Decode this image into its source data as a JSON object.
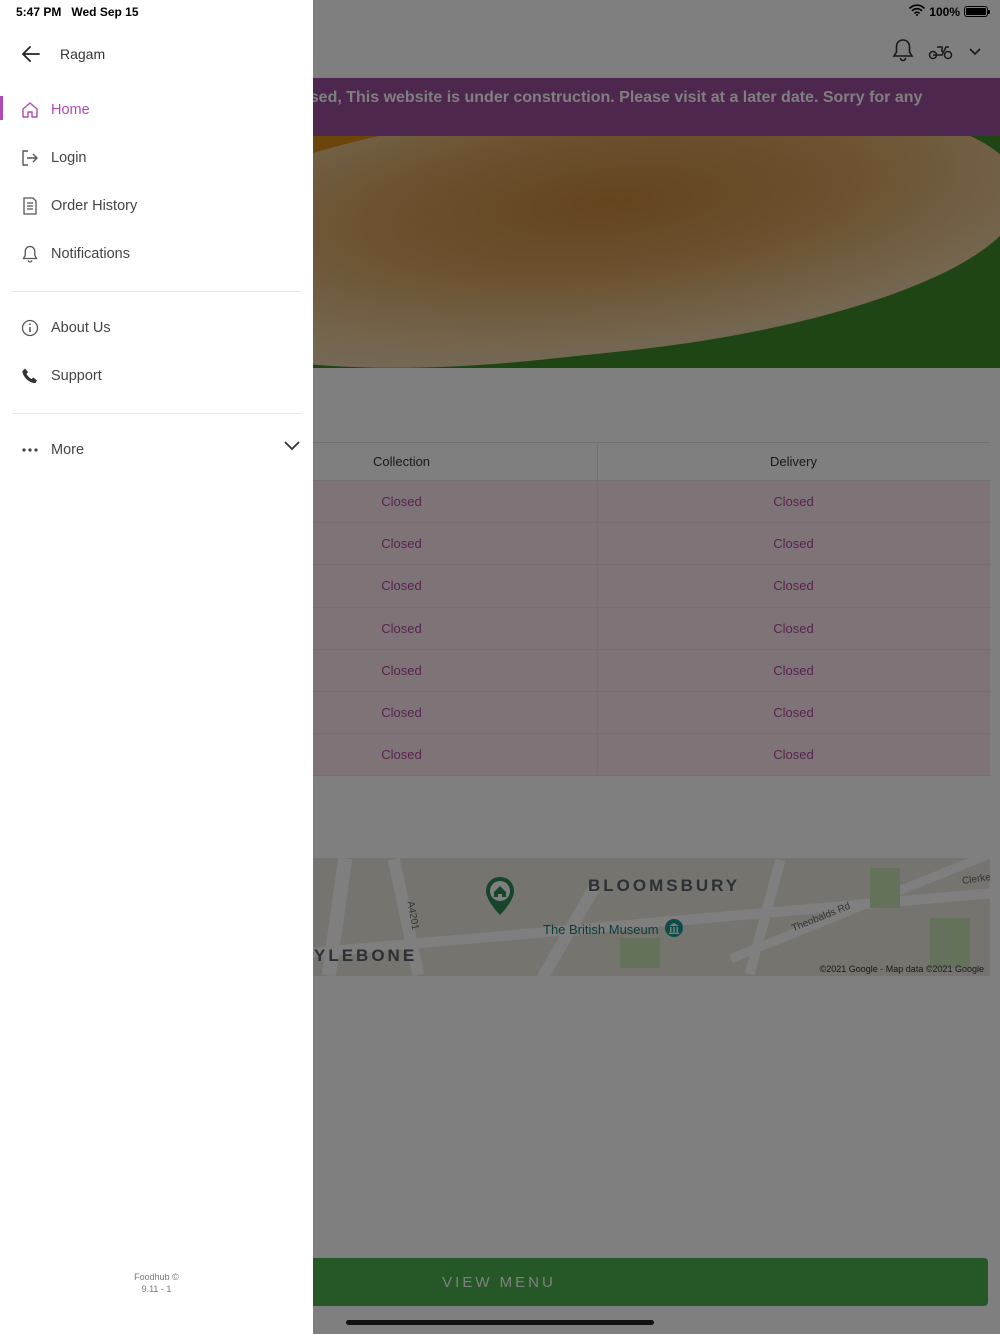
{
  "status_bar": {
    "time": "5:47 PM",
    "date": "Wed Sep 15",
    "battery": "100%"
  },
  "drawer": {
    "title": "Ragam",
    "items": [
      {
        "label": "Home",
        "icon": "home-icon",
        "active": true
      },
      {
        "label": "Login",
        "icon": "login-icon"
      },
      {
        "label": "Order History",
        "icon": "receipt-icon"
      },
      {
        "label": "Notifications",
        "icon": "bell-icon"
      },
      {
        "label": "About Us",
        "icon": "info-icon"
      },
      {
        "label": "Support",
        "icon": "phone-icon"
      },
      {
        "label": "More",
        "icon": "more-dots-icon"
      }
    ],
    "footer_line1": "Foodhub ©",
    "footer_line2": "9.11 - 1"
  },
  "main": {
    "banner": "osed, This website is under construction. Please visit at a later date. Sorry for any",
    "hours": {
      "col_collection": "Collection",
      "col_delivery": "Delivery",
      "rows": [
        {
          "collection": "Closed",
          "delivery": "Closed"
        },
        {
          "collection": "Closed",
          "delivery": "Closed"
        },
        {
          "collection": "Closed",
          "delivery": "Closed"
        },
        {
          "collection": "Closed",
          "delivery": "Closed"
        },
        {
          "collection": "Closed",
          "delivery": "Closed"
        },
        {
          "collection": "Closed",
          "delivery": "Closed"
        },
        {
          "collection": "Closed",
          "delivery": "Closed"
        }
      ]
    },
    "map": {
      "area_label": "BLOOMSBURY",
      "area_label2": "YLEBONE",
      "poi": "The British Museum",
      "road1": "A4201",
      "road2": "Theobalds Rd",
      "road3": "Clerke",
      "copyright": "©2021 Google - Map data ©2021 Google"
    },
    "view_menu": "VIEW MENU"
  },
  "colors": {
    "accent": "#b04ab5",
    "banner": "#9b4e9a",
    "button": "#4cae4f"
  }
}
